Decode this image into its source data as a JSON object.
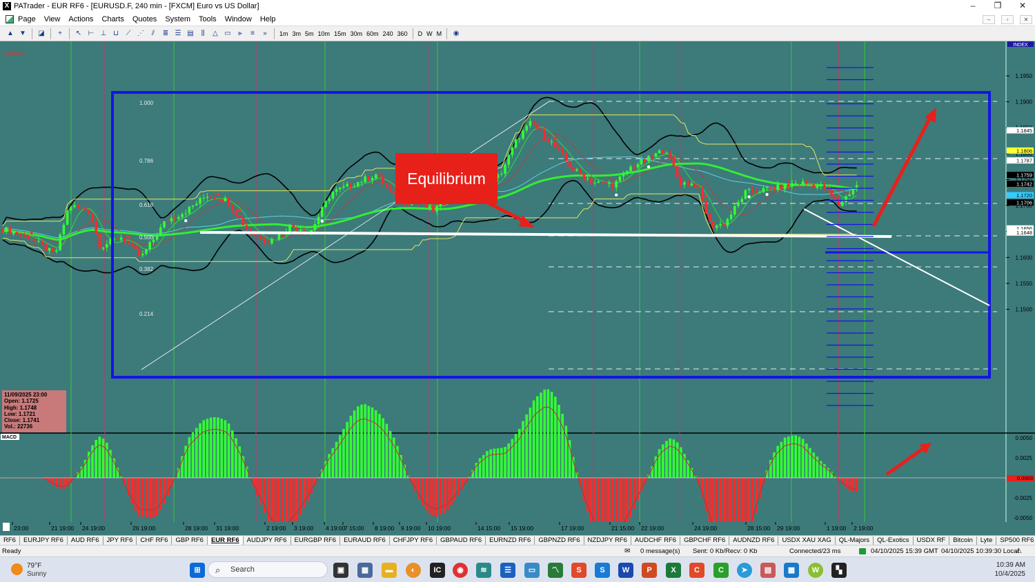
{
  "window": {
    "title": "PATrader - EUR RF6 - [EURUSD.F, 240 min - [FXCM] Euro vs US Dollar]",
    "app_icon_label": "X",
    "minimize": "–",
    "maximize": "❐",
    "close": "✕"
  },
  "menu": [
    "Page",
    "View",
    "Actions",
    "Charts",
    "Quotes",
    "System",
    "Tools",
    "Window",
    "Help"
  ],
  "mdi_controls": [
    "–",
    "▫",
    "✕"
  ],
  "toolbar": {
    "more": "»",
    "timeframes": [
      "1m",
      "3m",
      "5m",
      "10m",
      "15m",
      "30m",
      "60m",
      "240",
      "360",
      "D",
      "W",
      "M"
    ]
  },
  "chart": {
    "locked_label": "Locked",
    "index_label": "INDEX",
    "annotation": "Equilibrium",
    "fib_levels": [
      "1.000",
      "0.786",
      "0.618",
      "0.500",
      "0.382",
      "0.214"
    ],
    "price_axis": [
      "1.1950",
      "1.1900",
      "1.1850",
      "1.1800",
      "1.1750",
      "1.1700",
      "1.1650",
      "1.1600",
      "1.1550",
      "1.1500"
    ],
    "price_tags": [
      {
        "label": "1.1845",
        "color": "#ffffff"
      },
      {
        "label": "1.1806",
        "color": "#ffff33"
      },
      {
        "label": "1.1787",
        "color": "#ffffff"
      },
      {
        "label": "1.1759",
        "color": "#000000"
      },
      {
        "label": "1.1742",
        "color": "#000000"
      },
      {
        "label": "1.1720",
        "color": "#33ccff"
      },
      {
        "label": "1.1706",
        "color": "#000000"
      },
      {
        "label": "1.1656",
        "color": "#ffffff"
      },
      {
        "label": "1.1648",
        "color": "#ffffff"
      }
    ],
    "ohlc": {
      "date": "11/09/2025 23:00",
      "open": "Open: 1.1725",
      "high": "High: 1.1748",
      "low": "Low: 1.1721",
      "close": "Close: 1.1741",
      "vol": "Vol.: 22736"
    },
    "macd": {
      "label": "MACD",
      "axis": [
        "0.0050",
        "0.0025",
        "-0.0025",
        "-0.0050"
      ],
      "value_tag": "0.0003"
    },
    "time_axis": [
      "23:00",
      "21 19:00",
      "24 19:00",
      "26 19:00",
      "28 19:00",
      "31 19:00",
      "2 19:00",
      "3 19:00",
      "4 19:00",
      "7 15:00",
      "8 19:00",
      "9 19:00",
      "10 19:00",
      "14 15:00",
      "15 19:00",
      "17 19:00",
      "21 15:00",
      "22 19:00",
      "24 19:00",
      "28 15:00",
      "29 19:00",
      "1 19:00",
      "2 19:00"
    ],
    "colors": {
      "background": "#3d7a7a",
      "box": "#1414e6",
      "bull": "#33ff33",
      "bear": "#ff2a2a",
      "annotation": "#e8201a"
    }
  },
  "tabs": [
    "RF6",
    "EURJPY RF6",
    "AUD RF6",
    "JPY RF6",
    "CHF RF6",
    "GBP RF6",
    "EUR RF6",
    "AUDJPY RF6",
    "EURGBP RF6",
    "EURAUD RF6",
    "CHFJPY RF6",
    "GBPAUD RF6",
    "EURNZD RF6",
    "GBPNZD RF6",
    "NZDJPY RF6",
    "AUDCHF RF6",
    "GBPCHF RF6",
    "AUDNZD RF6",
    "USDX XAU XAG",
    "QL-Majors",
    "QL-Exotics",
    "USDX RF",
    "Bitcoin",
    "Lyte",
    "SP500 RF6",
    "DJIA",
    "Ethirium",
    "NASDAQ"
  ],
  "active_tab": "EUR RF6",
  "tab_nav": [
    "◄",
    "►"
  ],
  "status": {
    "ready": "Ready",
    "messages": "0 message(s)",
    "sent": "Sent: 0 Kb/Recv: 0 Kb",
    "connected": "Connected/23 ms",
    "gmt": "04/10/2025 15:39 GMT",
    "local": "04/10/2025 10:39:30 Local"
  },
  "taskbar": {
    "temp": "79°F",
    "condition": "Sunny",
    "search_placeholder": "Search",
    "time": "10:39 AM",
    "date": "10/4/2025"
  }
}
